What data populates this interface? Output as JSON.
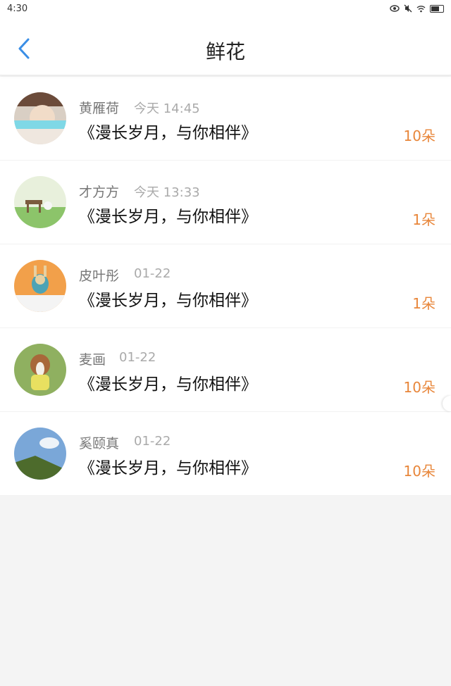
{
  "status_bar": {
    "time": "4:30"
  },
  "header": {
    "title": "鲜花"
  },
  "items": [
    {
      "name": "黄雁荷",
      "date": "今天 14:45",
      "message": "《漫长岁月，与你相伴》",
      "count": "10朵"
    },
    {
      "name": "才方方",
      "date": "今天 13:33",
      "message": "《漫长岁月，与你相伴》",
      "count": "1朵"
    },
    {
      "name": "皮叶彤",
      "date": "01-22",
      "message": "《漫长岁月，与你相伴》",
      "count": "1朵"
    },
    {
      "name": "麦画",
      "date": "01-22",
      "message": "《漫长岁月，与你相伴》",
      "count": "10朵"
    },
    {
      "name": "奚颐真",
      "date": "01-22",
      "message": "《漫长岁月，与你相伴》",
      "count": "10朵"
    }
  ],
  "colors": {
    "accent": "#3a8ee6",
    "count": "#e8863a"
  }
}
